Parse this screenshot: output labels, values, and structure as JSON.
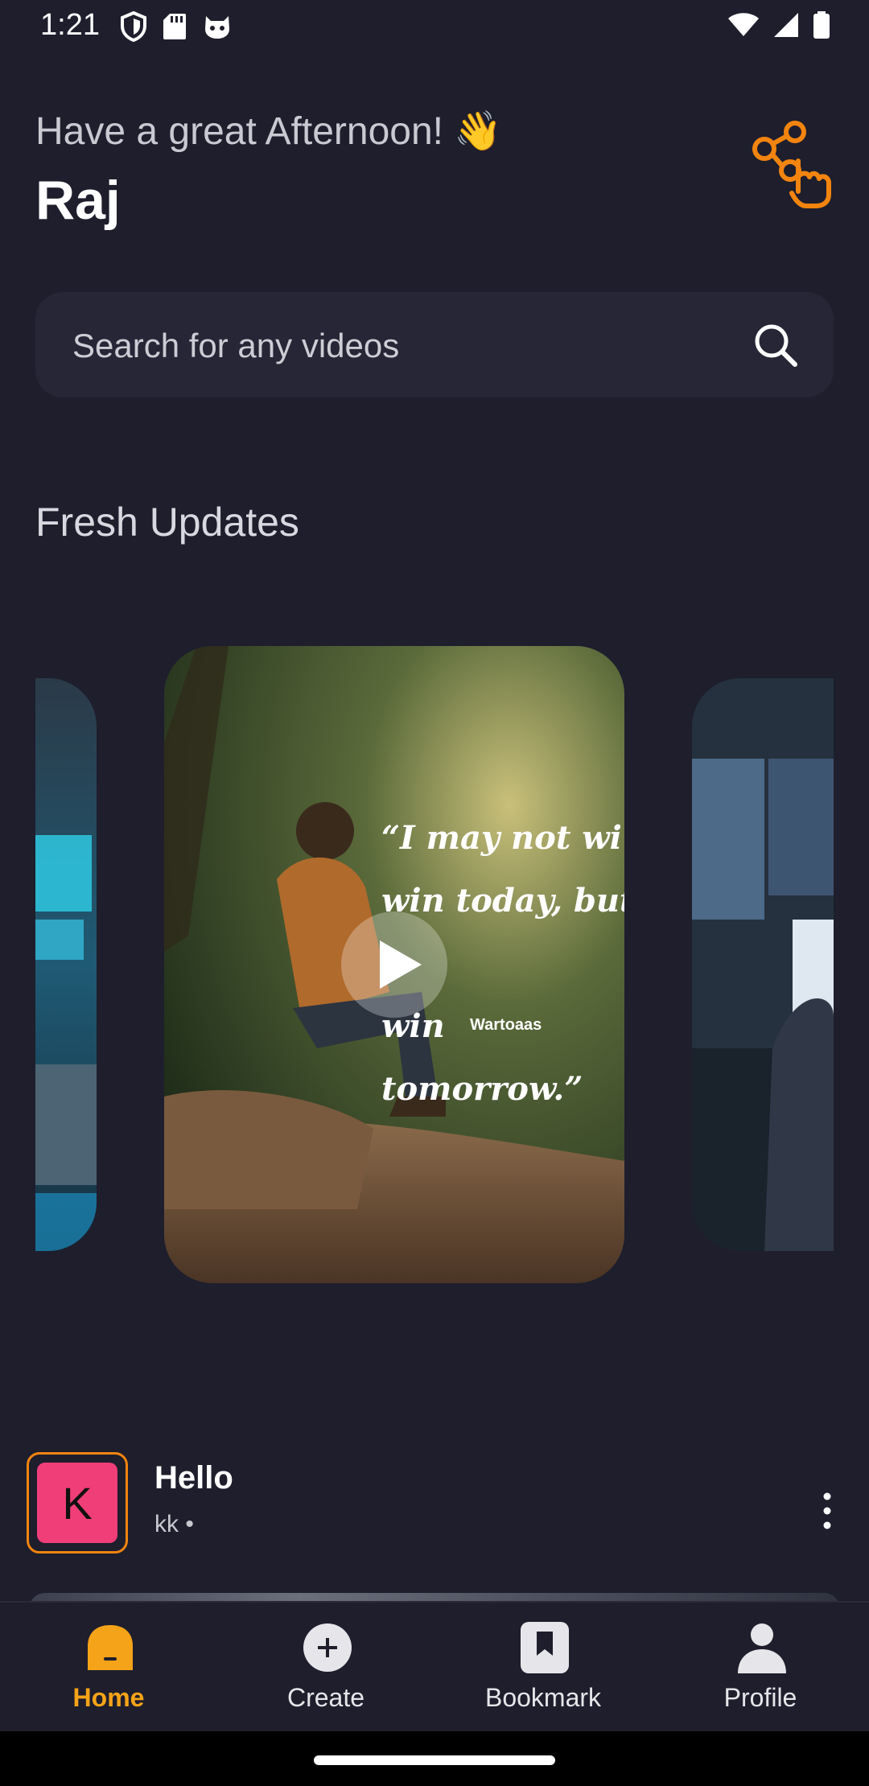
{
  "status_bar": {
    "time": "1:21"
  },
  "header": {
    "greeting": "Have a great Afternoon! 👋",
    "user_name": "Raj"
  },
  "search": {
    "placeholder": "Search for any videos"
  },
  "fresh_updates": {
    "title": "Fresh Updates",
    "main_card": {
      "quote": "“I  may  not  wi\nwin  today, but I \nwin tomorrow.”",
      "credit": "Wartoaas"
    }
  },
  "post": {
    "avatar_letter": "K",
    "title": "Hello",
    "subtitle": "kk",
    "subtitle_dot": "•"
  },
  "bottom_nav": {
    "items": [
      {
        "label": "Home",
        "icon": "home-icon",
        "active": true
      },
      {
        "label": "Create",
        "icon": "plus-circle-icon",
        "active": false
      },
      {
        "label": "Bookmark",
        "icon": "bookmark-icon",
        "active": false
      },
      {
        "label": "Profile",
        "icon": "person-icon",
        "active": false
      }
    ]
  },
  "colors": {
    "background": "#1e1e2d",
    "accent": "#f5a318",
    "avatar": "#f03e78",
    "search_bg": "#262636"
  }
}
